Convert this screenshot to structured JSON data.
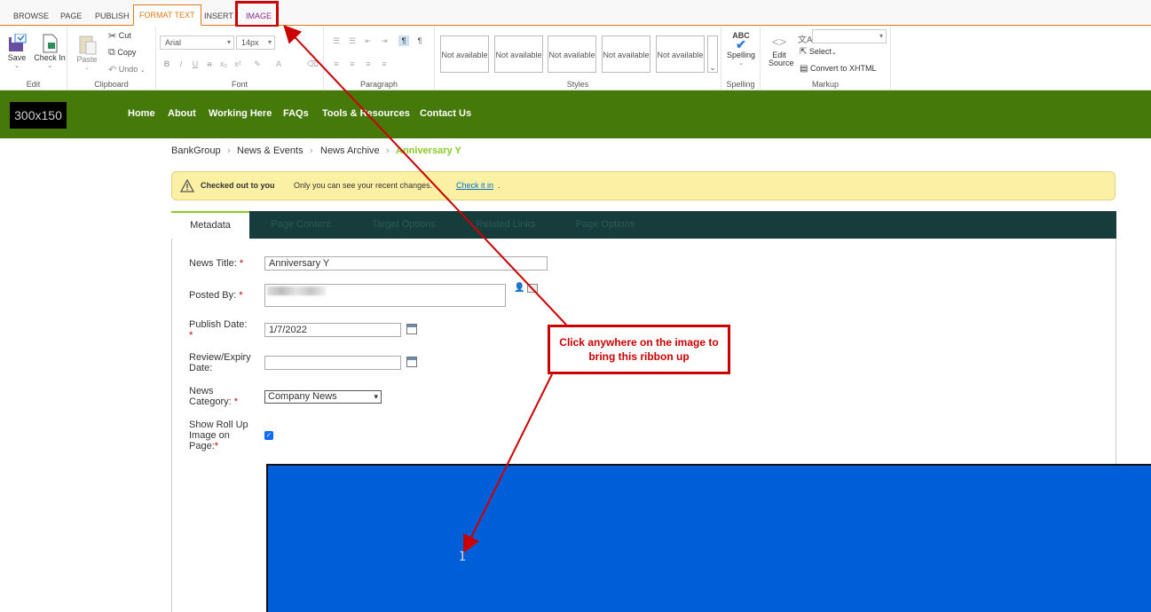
{
  "ribbon": {
    "tabs": [
      {
        "label": "BROWSE"
      },
      {
        "label": "PAGE"
      },
      {
        "label": "PUBLISH"
      },
      {
        "label": "FORMAT TEXT"
      },
      {
        "label": "INSERT"
      },
      {
        "label": "IMAGE"
      }
    ],
    "groups": {
      "edit": {
        "label": "Edit",
        "save": "Save",
        "check_in": "Check In"
      },
      "clipboard": {
        "label": "Clipboard",
        "paste": "Paste",
        "cut": "Cut",
        "copy": "Copy",
        "undo": "Undo"
      },
      "font": {
        "label": "Font",
        "family": "Arial",
        "size": "14px"
      },
      "paragraph": {
        "label": "Paragraph"
      },
      "styles": {
        "label": "Styles",
        "items": [
          "Not available",
          "Not available",
          "Not available",
          "Not available",
          "Not available"
        ]
      },
      "spelling": {
        "label": "Spelling",
        "button": "Spelling",
        "abc": "ABC"
      },
      "markup": {
        "label": "Markup",
        "edit_source": "Edit Source",
        "select": "Select",
        "convert": "Convert to XHTML"
      }
    }
  },
  "nav": {
    "logo": "300x150",
    "links": [
      "Home",
      "About",
      "Working Here",
      "FAQs",
      "Tools & Resources",
      "Contact Us"
    ]
  },
  "breadcrumb": [
    "BankGroup",
    "News & Events",
    "News Archive",
    "Anniversary Y"
  ],
  "alert": {
    "strong": "Checked out to you",
    "text": "Only you can see your recent changes.",
    "link": "Check it in",
    "period": "."
  },
  "page_tabs": [
    "Metadata",
    "Page Content",
    "Target Options",
    "Related Links",
    "Page Options"
  ],
  "form": {
    "news_title": {
      "label": "News Title:",
      "value": "Anniversary Y"
    },
    "posted_by": {
      "label": "Posted By:"
    },
    "publish_date": {
      "label": "Publish Date:",
      "value": "1/7/2022"
    },
    "review_date": {
      "label_1": "Review/Expiry",
      "label_2": "Date:",
      "value": ""
    },
    "news_category": {
      "label_1": "News",
      "label_2": "Category:",
      "value": "Company News"
    },
    "show_rollup": {
      "label_1": "Show Roll Up",
      "label_2": "Image on",
      "label_3": "Page:",
      "checked": true
    },
    "required_mark": "*"
  },
  "callout": {
    "line1": "Click anywhere on the image to",
    "line2": "bring this ribbon up"
  },
  "colors": {
    "nav_bg": "#457a0a",
    "tab_bg": "#173c3c",
    "image_bg": "#005ed9",
    "annotation": "#cc0000"
  }
}
